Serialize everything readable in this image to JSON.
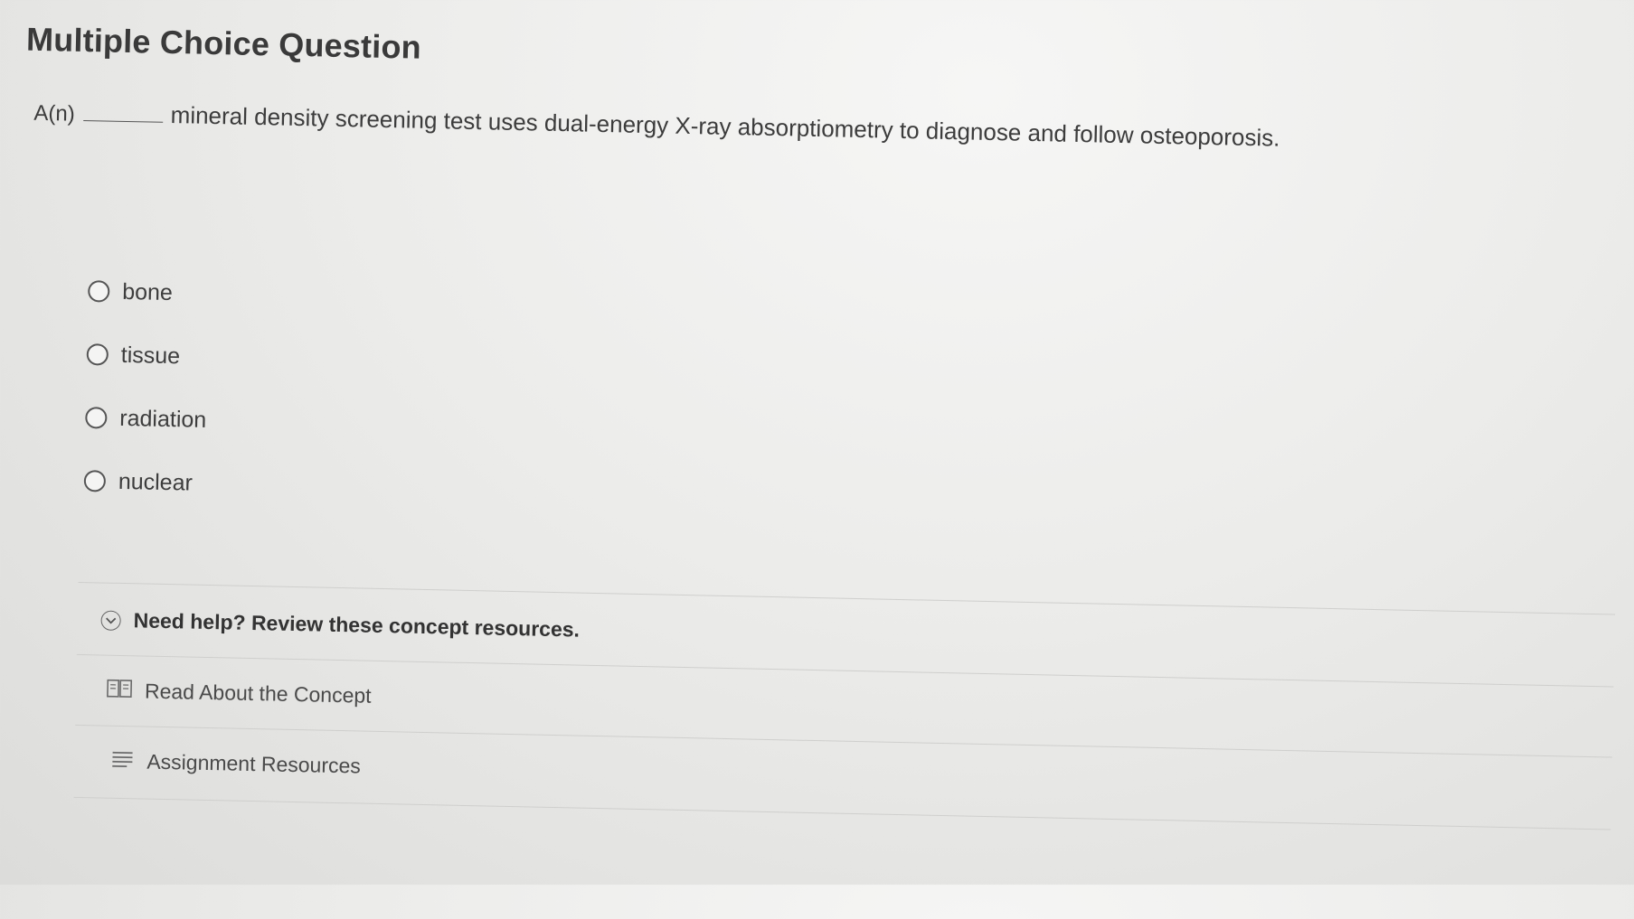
{
  "question": {
    "title": "Multiple Choice Question",
    "prefix": "A(n)",
    "text": "mineral density screening test uses dual-energy X-ray absorptiometry to diagnose and follow osteoporosis."
  },
  "options": [
    {
      "label": "bone"
    },
    {
      "label": "tissue"
    },
    {
      "label": "radiation"
    },
    {
      "label": "nuclear"
    }
  ],
  "help": {
    "toggle_label": "Need help? Review these concept resources.",
    "icon": "chevron-down-circle-icon"
  },
  "resources": [
    {
      "label": "Read About the Concept",
      "icon": "book-icon"
    },
    {
      "label": "Assignment Resources",
      "icon": "list-icon"
    }
  ]
}
